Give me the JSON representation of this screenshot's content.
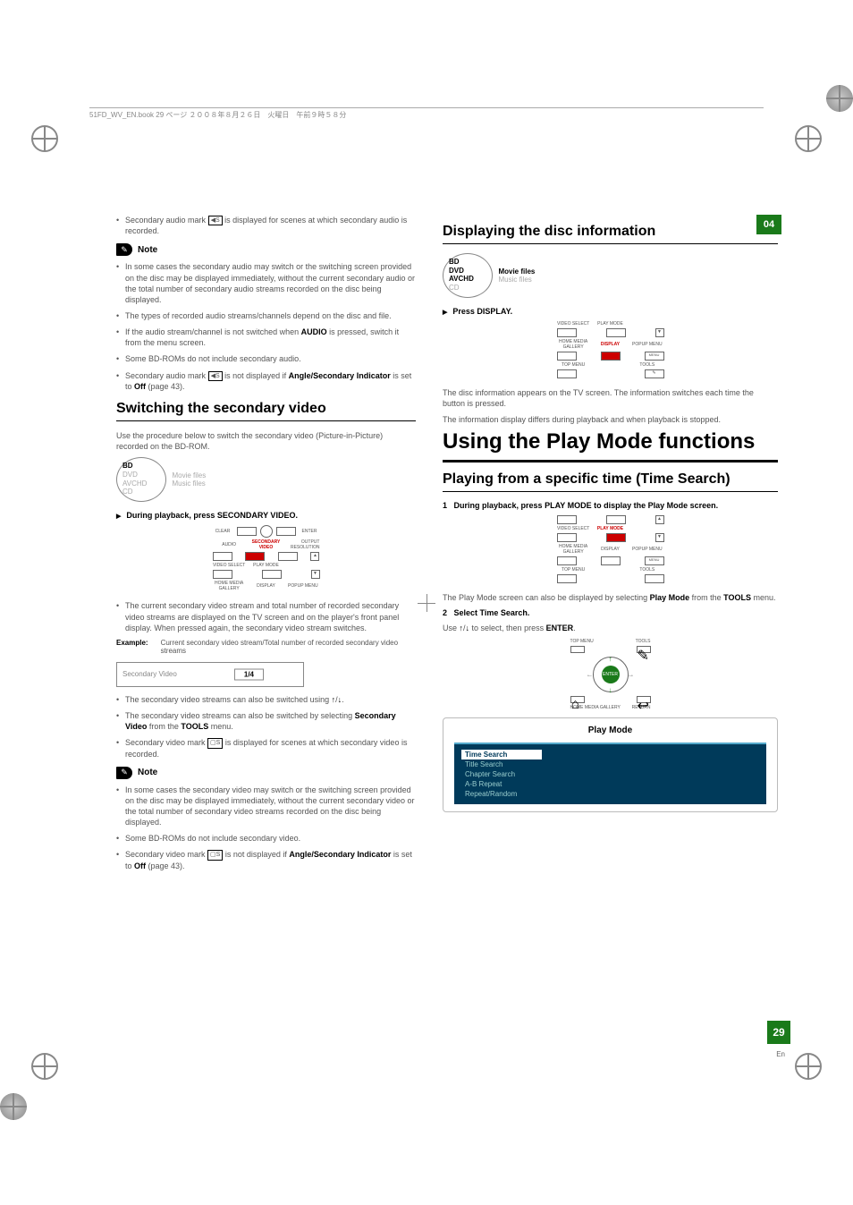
{
  "header_note": "51FD_WV_EN.book  29 ページ  ２００８年８月２６日　火曜日　午前９時５８分",
  "chapter": "04",
  "page_number": "29",
  "page_lang": "En",
  "left": {
    "intro_bullet": "Secondary audio mark  is displayed for scenes at which secondary audio is recorded.",
    "note_label": "Note",
    "note_items": [
      "In some cases the secondary audio may switch or the switching screen provided on the disc may be displayed immediately, without the current secondary audio or the total number of secondary audio streams recorded on the disc being displayed.",
      "The types of recorded audio streams/channels depend on the disc and file.",
      "If the audio stream/channel is not switched when AUDIO is pressed, switch it from the menu screen.",
      "Some BD-ROMs do not include secondary audio.",
      "Secondary audio mark  is not displayed if Angle/Secondary Indicator is set to Off (page 43)."
    ],
    "h2_switching": "Switching the secondary video",
    "switch_desc": "Use the procedure below to switch the secondary video (Picture-in-Picture) recorded on the BD-ROM.",
    "disc_types": {
      "bd": "BD",
      "dvd": "DVD",
      "avchd": "AVCHD",
      "cd": "CD"
    },
    "file_types": {
      "movie": "Movie files",
      "music": "Music files"
    },
    "step_playback": "During playback, press SECONDARY VIDEO.",
    "remote_labels": {
      "clear": "CLEAR",
      "enter": "ENTER",
      "audio": "AUDIO",
      "secondary": "SECONDARY",
      "video": "VIDEO",
      "output": "OUTPUT",
      "resolution": "RESOLUTION",
      "video_select": "VIDEO SELECT",
      "play_mode": "PLAY MODE",
      "home_media": "HOME MEDIA",
      "gallery": "GALLERY",
      "display": "DISPLAY",
      "popup": "POPUP MENU"
    },
    "current_video_bullet": "The current secondary video stream and total number of recorded secondary video streams are displayed on the TV screen and on the player's front panel display. When pressed again, the secondary video stream switches.",
    "example_label": "Example:",
    "example_desc": "Current secondary video stream/Total number of recorded secondary video streams",
    "secondary_box_label": "Secondary Video",
    "secondary_box_value": "1/4",
    "bullets_after": [
      "The secondary video streams can also be switched using ↑/↓.",
      "The secondary video streams can also be switched by selecting Secondary Video from the TOOLS menu.",
      "Secondary video mark  is displayed for scenes at which secondary video is recorded."
    ],
    "note2_items": [
      "In some cases the secondary video may switch or the switching screen provided on the disc may be displayed immediately, without the current secondary video or the total number of secondary video streams recorded on the disc being displayed.",
      "Some BD-ROMs do not include secondary video.",
      "Secondary video mark  is not displayed if Angle/Secondary Indicator is set to Off (page 43)."
    ]
  },
  "right": {
    "h2_display": "Displaying the disc information",
    "step_display": "Press DISPLAY.",
    "remote_labels2": {
      "video_select": "VIDEO SELECT",
      "play_mode": "PLAY MODE",
      "home_media": "HOME MEDIA",
      "gallery": "GALLERY",
      "display": "DISPLAY",
      "popup": "POPUP MENU",
      "top_menu": "TOP MENU",
      "tools": "TOOLS",
      "menu": "MENU"
    },
    "disc_info_1": "The disc information appears on the TV screen. The information switches each time the button is pressed.",
    "disc_info_2": "The information display differs during playback and when playback is stopped.",
    "h1_using": "Using the Play Mode functions",
    "h2_playing": "Playing from a specific time (Time Search)",
    "step1_num": "1",
    "step1": "During playback, press PLAY MODE to display the Play Mode screen.",
    "after_remote": "The Play Mode screen can also be displayed by selecting Play Mode from the TOOLS menu.",
    "step2_num": "2",
    "step2": "Select Time Search.",
    "step2_desc": "Use ↑/↓ to select, then press ENTER.",
    "dpad": {
      "top_menu": "TOP MENU",
      "tools": "TOOLS",
      "home_media": "HOME MEDIA GALLERY",
      "return": "RETURN",
      "enter": "ENTER"
    },
    "playmode_title": "Play Mode",
    "playmode_items": [
      "Time Search",
      "Title Search",
      "Chapter Search",
      "A-B Repeat",
      "Repeat/Random"
    ]
  }
}
